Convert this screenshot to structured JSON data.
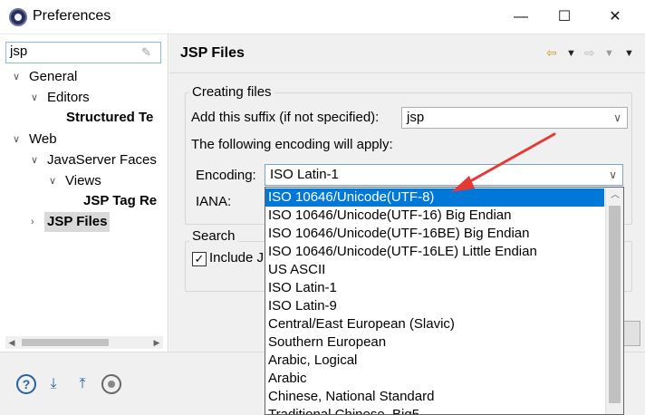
{
  "window": {
    "title": "Preferences",
    "minimize": "—",
    "maximize": "☐",
    "close": "✕"
  },
  "filter": {
    "value": "jsp",
    "clear_icon": "eraser-icon"
  },
  "tree": {
    "items": [
      {
        "label": "General",
        "expanded": true
      },
      {
        "label": "Editors",
        "expanded": true
      },
      {
        "label": "Structured Te"
      },
      {
        "label": "Web",
        "expanded": true
      },
      {
        "label": "JavaServer Faces",
        "expanded": true
      },
      {
        "label": "Views",
        "expanded": true
      },
      {
        "label": "JSP Tag Re"
      },
      {
        "label": "JSP Files",
        "selected": true
      }
    ]
  },
  "page": {
    "title": "JSP Files"
  },
  "creating_files": {
    "group_label": "Creating files",
    "suffix_label": "Add this suffix (if not specified):",
    "suffix_value": "jsp",
    "encoding_info": "The following encoding will apply:",
    "encoding_label": "Encoding:",
    "encoding_value": "ISO Latin-1",
    "iana_label": "IANA:"
  },
  "search": {
    "group_label": "Search",
    "include_label": "Include J"
  },
  "encoding_options": [
    "ISO 10646/Unicode(UTF-8)",
    "ISO 10646/Unicode(UTF-16) Big Endian",
    "ISO 10646/Unicode(UTF-16BE) Big Endian",
    "ISO 10646/Unicode(UTF-16LE) Little Endian",
    "US ASCII",
    "ISO Latin-1",
    "ISO Latin-9",
    "Central/East European (Slavic)",
    "Southern European",
    "Arabic, Logical",
    "Arabic",
    "Chinese, National Standard",
    "Traditional Chinese, Big5"
  ],
  "selected_option": "ISO 10646/Unicode(UTF-8)",
  "colors": {
    "selection": "#0078d7",
    "annotation": "#e53935"
  }
}
